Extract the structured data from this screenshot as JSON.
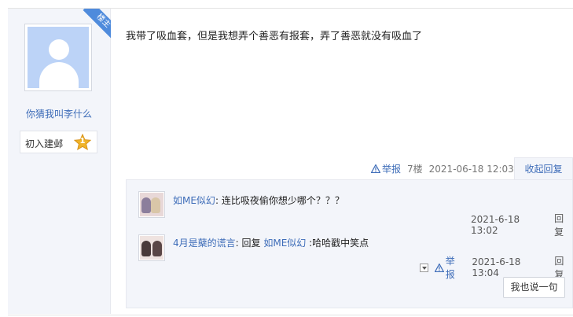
{
  "author": {
    "ribbon_label": "楼主",
    "name": "你猜我叫李什么",
    "level_title": "初入建邺",
    "level_number": "1"
  },
  "post": {
    "content": "我带了吸血套，但是我想弄个善恶有报套，弄了善恶就没有吸血了",
    "report_label": "举报",
    "floor": "7楼",
    "time": "2021-06-18 12:03",
    "collapse_label": "收起回复"
  },
  "replies": [
    {
      "user": "如ME似幻",
      "separator": ":",
      "text": "连比吸夜偷你想少哪个？？？",
      "time": "2021-6-18 13:02",
      "reply_label": "回复"
    },
    {
      "user": "4月是蘖的谎言",
      "separator": ":",
      "prefix": "回复",
      "target": "如ME似幻",
      "text": ":哈哈戳中笑点",
      "report_label": "举报",
      "time": "2021-6-18 13:04",
      "reply_label": "回复"
    }
  ],
  "say_button_label": "我也说一句",
  "colors": {
    "link": "#3d6cb8",
    "ribbon": "#4f8bdc",
    "panel_bg": "#f3f5fa",
    "badge": "#f0b429"
  }
}
